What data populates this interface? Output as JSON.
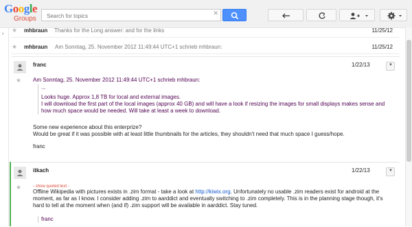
{
  "header": {
    "logo_main": "Google",
    "logo_sub": "Groups",
    "search_placeholder": "Search for topics",
    "search_clear": "✕"
  },
  "icons": {
    "back": "back-arrow-icon",
    "refresh": "refresh-icon",
    "add_person": "add-person-icon",
    "settings": "gear-icon"
  },
  "rows": [
    {
      "author": "mhbraun",
      "snippet": "Thanks for the   Long answer: and for the links",
      "date": "11/25/12"
    },
    {
      "author": "mhbraun",
      "snippet": "Am Sonntag, 25. November 2012 11:49:44 UTC+1 schrieb mhbraun:",
      "date": "11/25/12"
    }
  ],
  "post1": {
    "author": "franc",
    "date": "1/22/13",
    "quote_header": "Am Sonntag, 25. November 2012 11:49:44 UTC+1 schrieb mhbraun:",
    "quote_ellipsis": "...",
    "quote_line1": "Looks huge. Approx 1,8 TB for local and external images.",
    "quote_line2": "I will download the first part of the local images (approx 40 GB) and will have a look if resizing the images for small displays makes sense and",
    "quote_line3": "how much space would be needed. Will take at least a week to download.",
    "body_line1": "Some new experience about this enterprize?",
    "body_line2": "Would be great if it was possible with at least little thumbnails for the articles, they shouldn't need that much space I guess/hope.",
    "signature": "franc"
  },
  "post2": {
    "author": "itkach",
    "date": "1/22/13",
    "show_quoted": "- show quoted text -",
    "text_a": "Offline Wikipedia with pictures exists in .zim format - take a look at",
    "link": "http://kiwix.org",
    "text_b": ". Unfortunately no usable .zim readers exist for android at the",
    "line2": "moment, as far as I know. I consider adding .zim to aarddict and eventually switching to .zim completely. This is in the planning stage though, it's",
    "line3": "hard to tell at the moment when (and if) .zim support will be available in aarddict. Stay tuned.",
    "trailing": "franc"
  },
  "colors": {
    "accent_blue": "#4d90fe",
    "quote_purple": "#500050",
    "link_blue": "#1155cc",
    "new_marker_green": "#4caf50"
  }
}
